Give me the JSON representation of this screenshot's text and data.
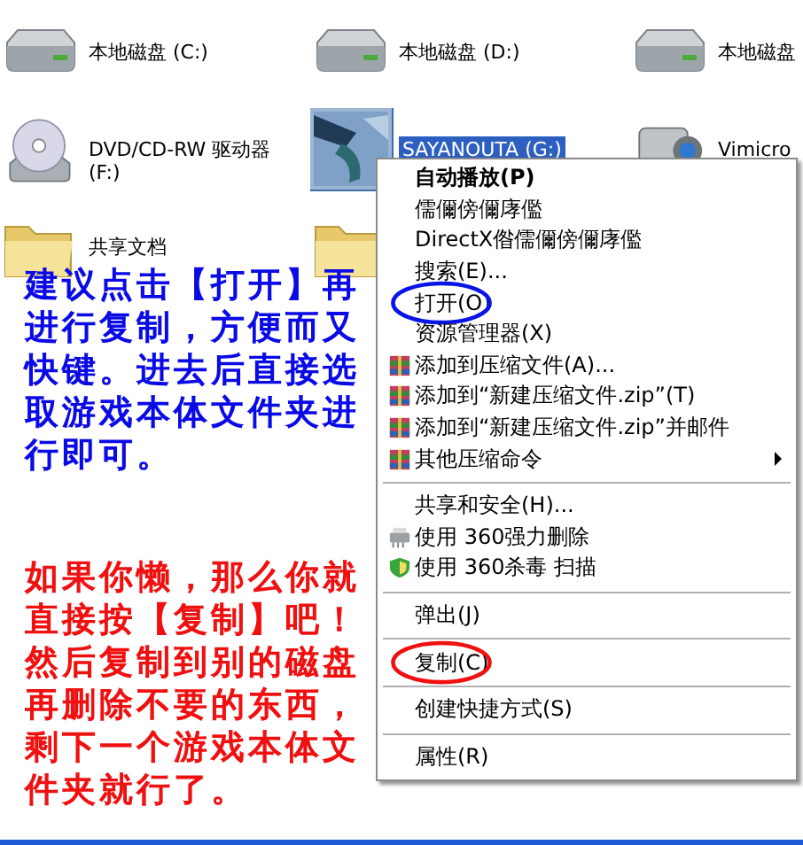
{
  "explorer_items": [
    {
      "label": "本地磁盘 (C:)",
      "kind": "disk",
      "selected": false
    },
    {
      "label": "本地磁盘 (D:)",
      "kind": "disk",
      "selected": false
    },
    {
      "label": "本地磁盘",
      "kind": "disk",
      "selected": false
    },
    {
      "label": "DVD/CD-RW 驱动器 (F:)",
      "kind": "cd",
      "selected": false
    },
    {
      "label": "SAYANOUTA (G:)",
      "selected": true
    },
    {
      "label": "Vimicro",
      "kind": "camera",
      "selected": false
    },
    {
      "label": "共享文档",
      "kind": "folder",
      "selected": false
    },
    {
      "kind": "folder",
      "selected": false
    }
  ],
  "context_menu": [
    {
      "kind": "default",
      "label": "自动播放(P)"
    },
    {
      "kind": "item",
      "label": "儒儞傍儞庨儖"
    },
    {
      "kind": "item",
      "label": "DirectX偺儒儞傍儞庨儖"
    },
    {
      "kind": "item",
      "label": "搜索(E)..."
    },
    {
      "kind": "item",
      "label": "打开(O)",
      "color": "#0a14e6"
    },
    {
      "kind": "item",
      "label": "资源管理器(X)"
    },
    {
      "kind": "archive",
      "label": "添加到压缩文件(A)..."
    },
    {
      "kind": "archive",
      "label": "添加到“新建压缩文件.zip”(T)"
    },
    {
      "kind": "archive",
      "label": "添加到“新建压缩文件.zip”并邮件"
    },
    {
      "kind": "archivesub",
      "label": "其他压缩命令"
    },
    {
      "kind": "separator"
    },
    {
      "kind": "item",
      "label": "共享和安全(H)..."
    },
    {
      "kind": "shredder",
      "label": "使用 360强力删除"
    },
    {
      "kind": "shield",
      "label": "使用 360杀毒 扫描"
    },
    {
      "kind": "separator"
    },
    {
      "kind": "item",
      "label": "弹出(J)"
    },
    {
      "kind": "separator"
    },
    {
      "kind": "item",
      "label": "复制(C)",
      "color": "#f01010"
    },
    {
      "kind": "separator"
    },
    {
      "kind": "item",
      "label": "创建快捷方式(S)"
    },
    {
      "kind": "separator"
    },
    {
      "kind": "item",
      "label": "属性(R)"
    }
  ],
  "annotations": [
    {
      "text": "建议点击【打开】再进行复制，方便而又快键。进去后直接选取游戏本体文件夹进行即可。",
      "color": "#0a0ae6"
    },
    {
      "text": "如果你懒，那么你就直接按【复制】吧！然后复制到别的磁盘再删除不要的东西，剩下一个游戏本体文件夹就行了。",
      "color": "#f01010"
    }
  ]
}
